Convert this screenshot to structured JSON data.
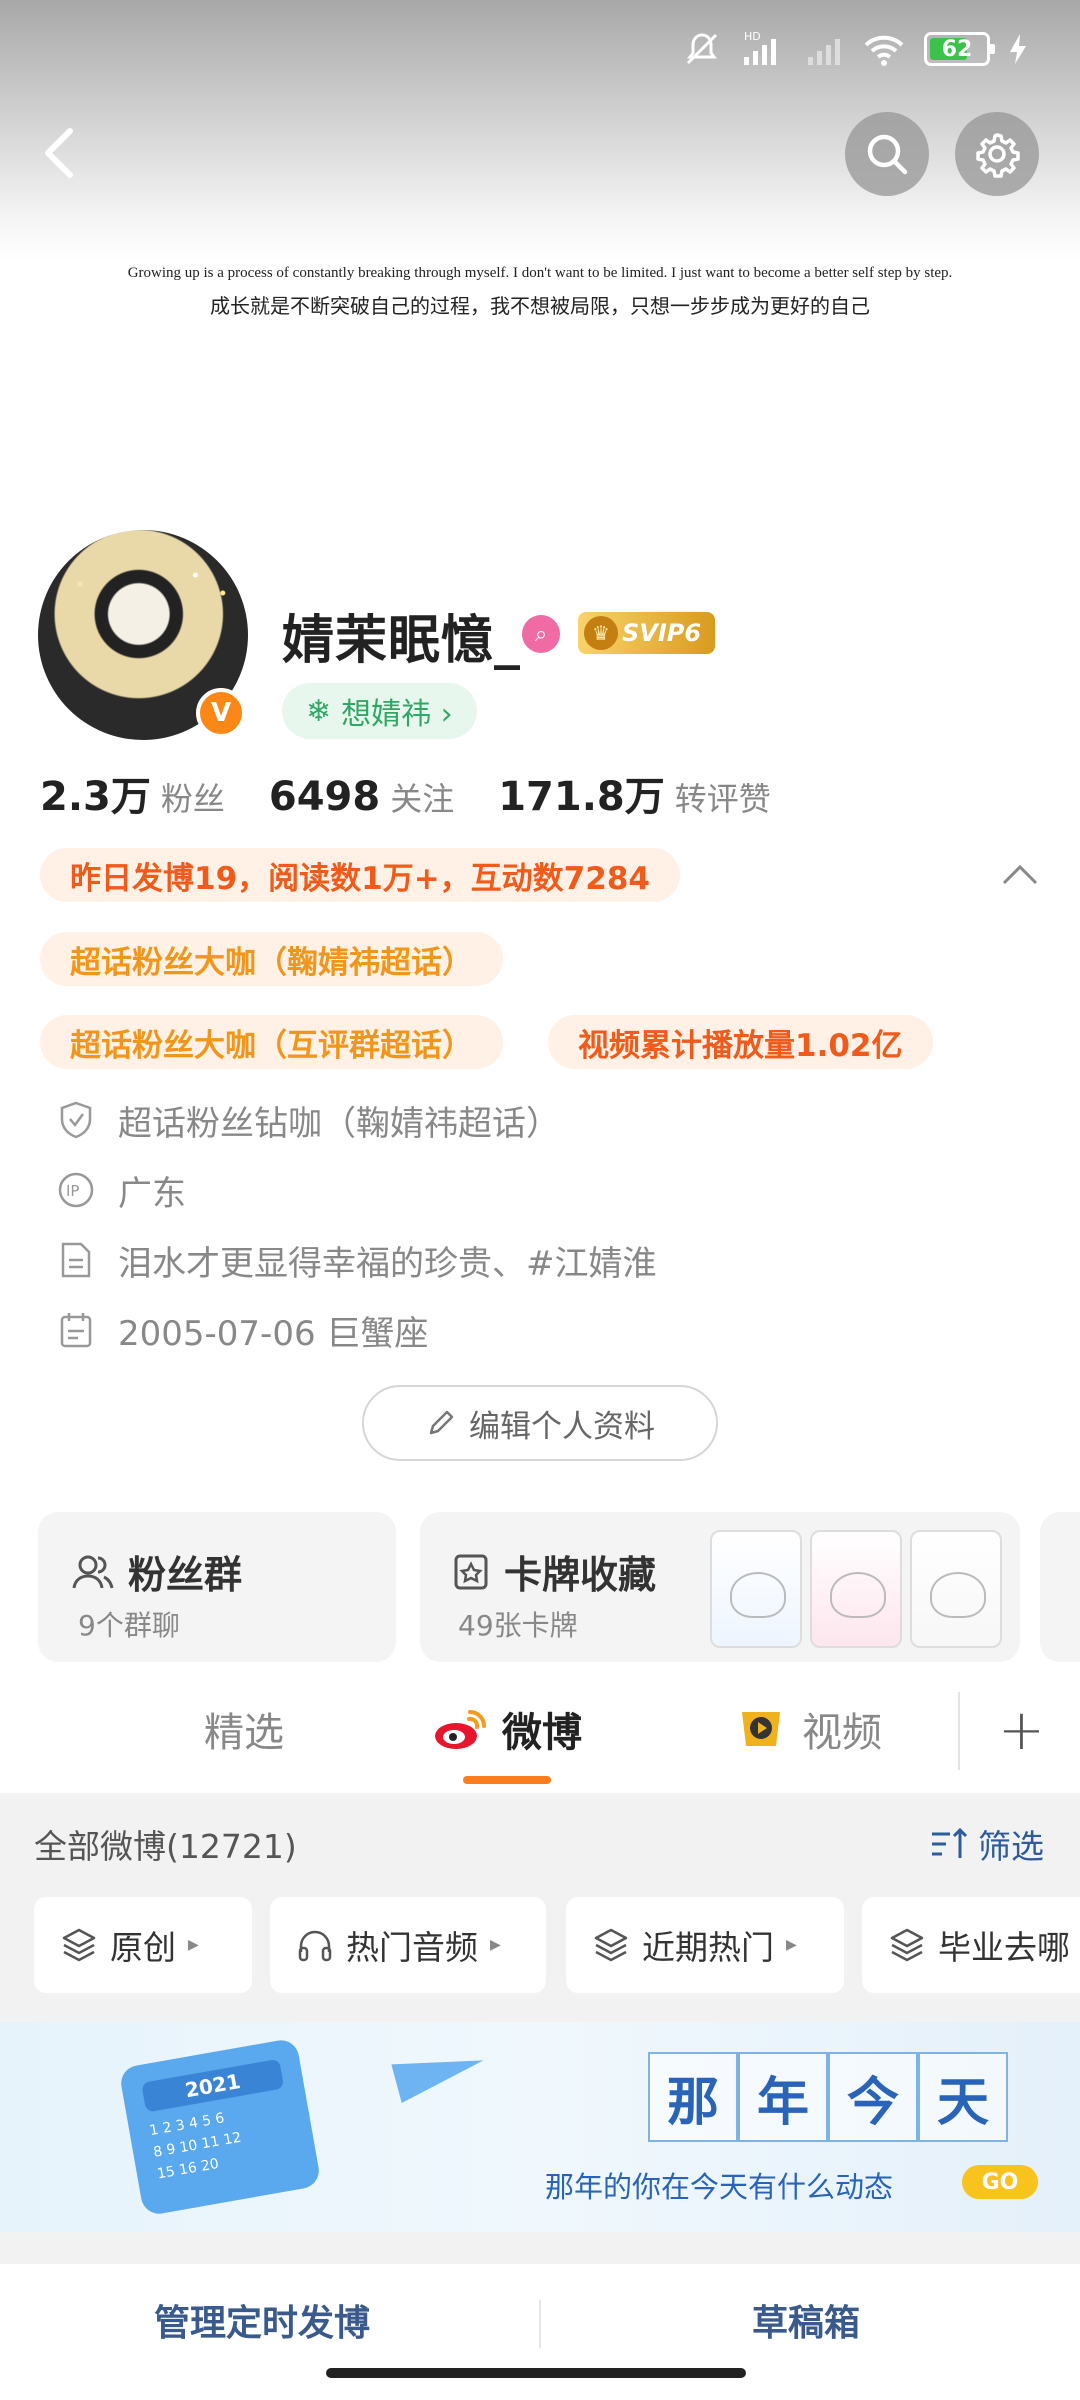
{
  "status": {
    "battery": "62",
    "network": "HD"
  },
  "banner": {
    "motto_en": "Growing up is a process of constantly breaking through myself. I don't want to be limited. I just want to become a better self step by step.",
    "motto_cn": "成长就是不断突破自己的过程，我不想被局限，只想一步步成为更好的自己"
  },
  "profile": {
    "username": "婧茉眠憶_",
    "verified_badge": "V",
    "svip": "SVIP6",
    "fan_tag": "想婧祎 ›"
  },
  "stats": [
    {
      "num": "2.3万",
      "label": "粉丝"
    },
    {
      "num": "6498",
      "label": "关注"
    },
    {
      "num": "171.8万",
      "label": "转评赞"
    }
  ],
  "pills": {
    "yesterday": "昨日发博19，阅读数1万+，互动数7284",
    "superfan1": "超话粉丝大咖（鞠婧祎超话）",
    "superfan2": "超话粉丝大咖（互评群超话）",
    "video": "视频累计播放量1.02亿"
  },
  "info": {
    "diamond": "超话粉丝钻咖（鞠婧祎超话）",
    "ip": "广东",
    "bio": "泪水才更显得幸福的珍贵、#江婧淮",
    "birthday": "2005-07-06 巨蟹座"
  },
  "edit_button": "编辑个人资料",
  "cards": {
    "fans_title": "粉丝群",
    "fans_sub": "9个群聊",
    "cards_title": "卡牌收藏",
    "cards_sub": "49张卡牌"
  },
  "tabs": {
    "featured": "精选",
    "weibo": "微博",
    "video": "视频"
  },
  "feed": {
    "header": "全部微博(12721)",
    "filter": "筛选",
    "chips": [
      "原创",
      "热门音频",
      "近期热门",
      "毕业去哪"
    ]
  },
  "memory": {
    "year": "2021",
    "chars": [
      "那",
      "年",
      "今",
      "天"
    ],
    "subtitle": "那年的你在今天有什么动态",
    "go": "GO"
  },
  "bottom": {
    "scheduled": "管理定时发博",
    "drafts": "草稿箱"
  },
  "colors": {
    "accent": "#fa7d1e",
    "orange_text": "#f05a1a",
    "link_blue": "#2e5b9c"
  }
}
